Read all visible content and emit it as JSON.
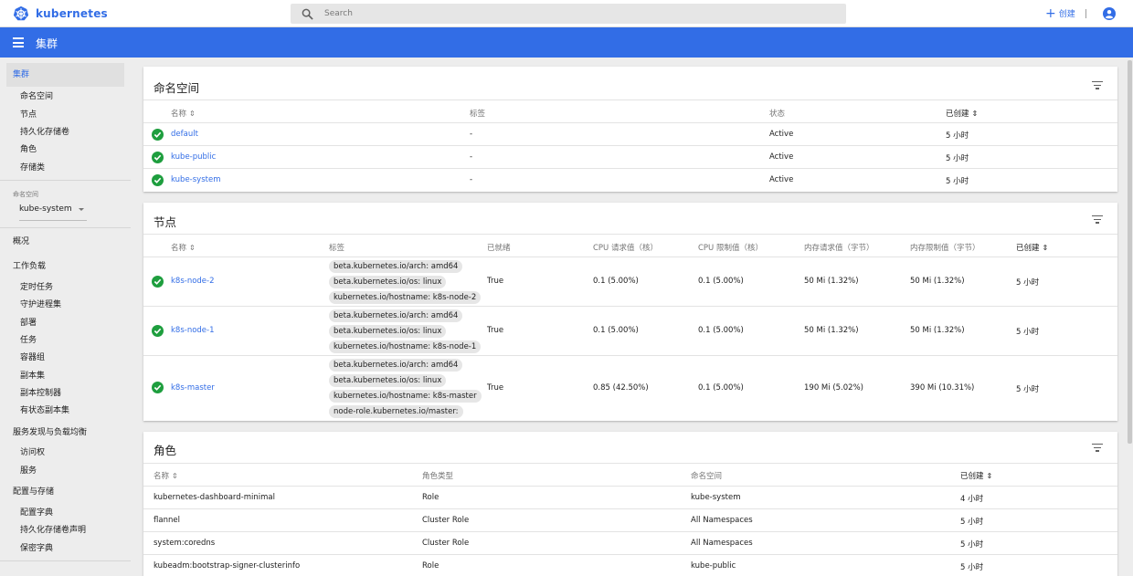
{
  "header": {
    "logo_text": "kubernetes",
    "search_placeholder": "Search",
    "create_label": "创建"
  },
  "bluebar": {
    "title": "集群"
  },
  "sidebar": {
    "active_item": "集群",
    "cluster_items": [
      "命名空间",
      "节点",
      "持久化存储卷",
      "角色",
      "存储类"
    ],
    "namespace_label": "命名空间",
    "namespace_value": "kube-system",
    "overview": "概况",
    "workloads": "工作负载",
    "workload_items": [
      "定时任务",
      "守护进程集",
      "部署",
      "任务",
      "容器组",
      "副本集",
      "副本控制器",
      "有状态副本集"
    ],
    "discovery": "服务发现与负载均衡",
    "discovery_items": [
      "访问权",
      "服务"
    ],
    "config": "配置与存储",
    "config_items": [
      "配置字典",
      "持久化存储卷声明",
      "保密字典"
    ]
  },
  "namespaces": {
    "title": "命名空间",
    "headers": [
      "名称",
      "标签",
      "状态",
      "已创建"
    ],
    "rows": [
      {
        "name": "default",
        "labels": "-",
        "status": "Active",
        "created": "5 小时"
      },
      {
        "name": "kube-public",
        "labels": "-",
        "status": "Active",
        "created": "5 小时"
      },
      {
        "name": "kube-system",
        "labels": "-",
        "status": "Active",
        "created": "5 小时"
      }
    ]
  },
  "nodes": {
    "title": "节点",
    "headers": [
      "名称",
      "标签",
      "已就绪",
      "CPU 请求值（核）",
      "CPU 限制值（核）",
      "内存请求值（字节）",
      "内存限制值（字节）",
      "已创建"
    ],
    "rows": [
      {
        "name": "k8s-node-2",
        "labels": [
          "beta.kubernetes.io/arch: amd64",
          "beta.kubernetes.io/os: linux",
          "kubernetes.io/hostname: k8s-node-2"
        ],
        "ready": "True",
        "cpu_req": "0.1 (5.00%)",
        "cpu_lim": "0.1 (5.00%)",
        "mem_req": "50 Mi (1.32%)",
        "mem_lim": "50 Mi (1.32%)",
        "created": "5 小时"
      },
      {
        "name": "k8s-node-1",
        "labels": [
          "beta.kubernetes.io/arch: amd64",
          "beta.kubernetes.io/os: linux",
          "kubernetes.io/hostname: k8s-node-1"
        ],
        "ready": "True",
        "cpu_req": "0.1 (5.00%)",
        "cpu_lim": "0.1 (5.00%)",
        "mem_req": "50 Mi (1.32%)",
        "mem_lim": "50 Mi (1.32%)",
        "created": "5 小时"
      },
      {
        "name": "k8s-master",
        "labels": [
          "beta.kubernetes.io/arch: amd64",
          "beta.kubernetes.io/os: linux",
          "kubernetes.io/hostname: k8s-master",
          "node-role.kubernetes.io/master:"
        ],
        "ready": "True",
        "cpu_req": "0.85 (42.50%)",
        "cpu_lim": "0.1 (5.00%)",
        "mem_req": "190 Mi (5.02%)",
        "mem_lim": "390 Mi (10.31%)",
        "created": "5 小时"
      }
    ]
  },
  "roles": {
    "title": "角色",
    "headers": [
      "名称",
      "角色类型",
      "命名空间",
      "已创建"
    ],
    "rows": [
      {
        "name": "kubernetes-dashboard-minimal",
        "type": "Role",
        "namespace": "kube-system",
        "created": "4 小时"
      },
      {
        "name": "flannel",
        "type": "Cluster Role",
        "namespace": "All Namespaces",
        "created": "5 小时"
      },
      {
        "name": "system:coredns",
        "type": "Cluster Role",
        "namespace": "All Namespaces",
        "created": "5 小时"
      },
      {
        "name": "kubeadm:bootstrap-signer-clusterinfo",
        "type": "Role",
        "namespace": "kube-public",
        "created": "5 小时"
      }
    ]
  },
  "colors": {
    "brand_blue": "#326de6",
    "ok_green": "#1e9e3e"
  }
}
